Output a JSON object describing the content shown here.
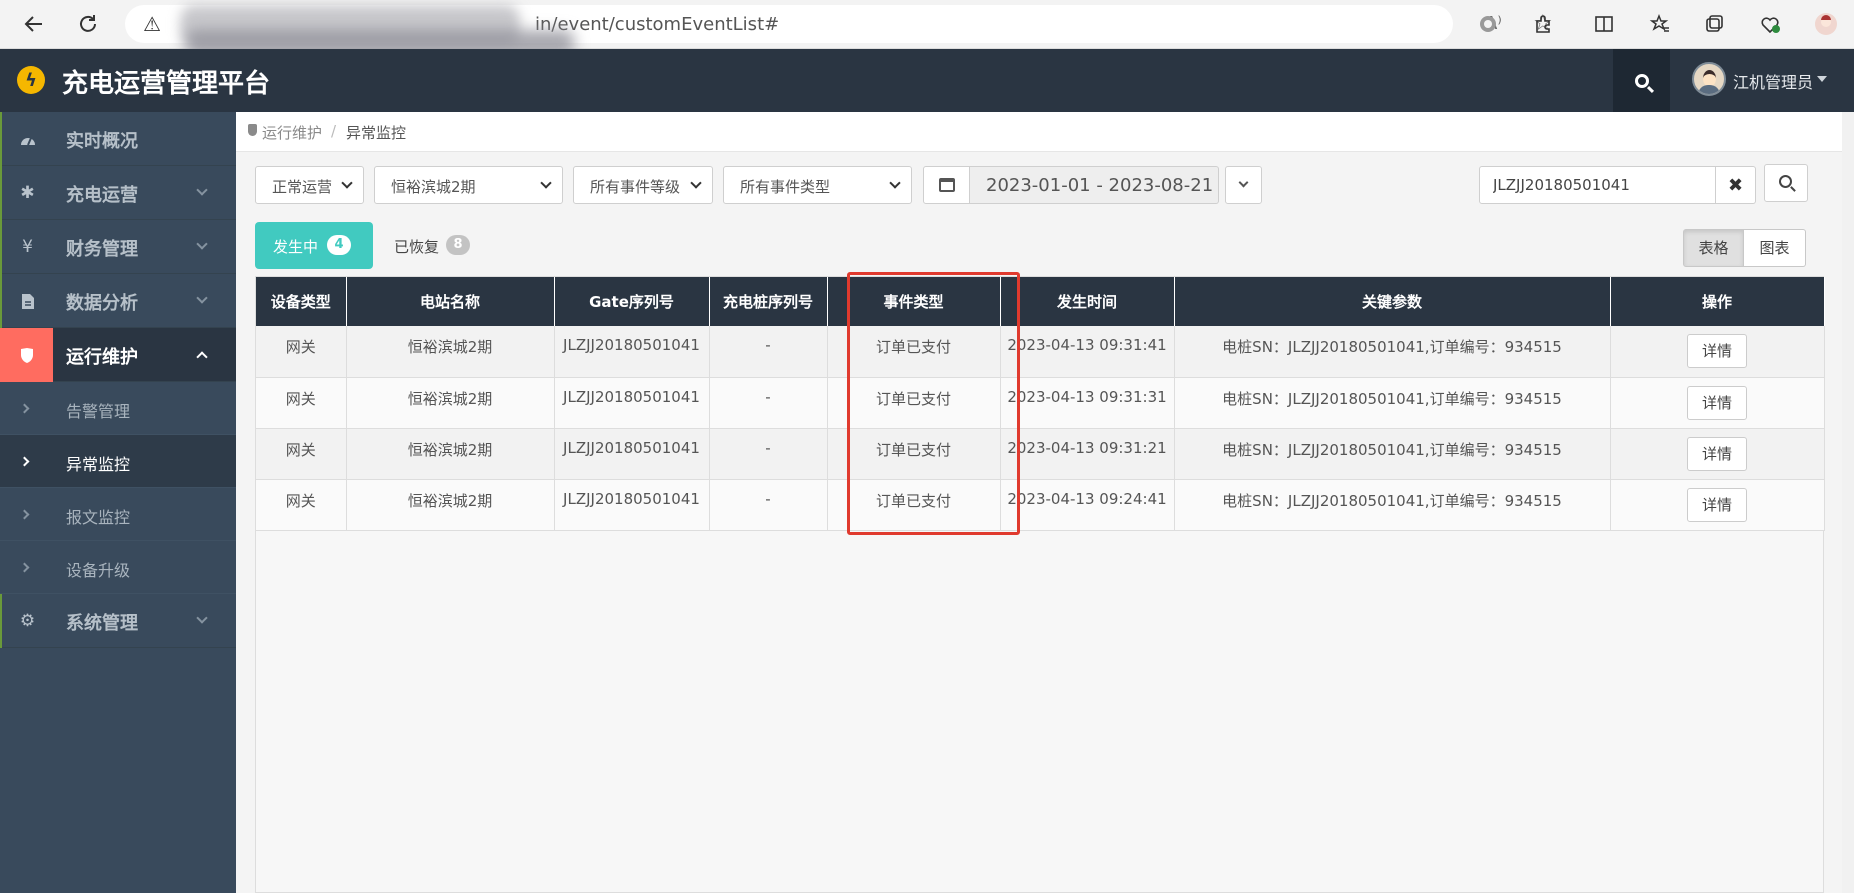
{
  "browser": {
    "url": "in/event/customEventList#",
    "read_aloud": "A⁾"
  },
  "app": {
    "title": "充电运营管理平台",
    "user": "江机管理员"
  },
  "sidebar": {
    "items": [
      {
        "label": "实时概况"
      },
      {
        "label": "充电运营"
      },
      {
        "label": "财务管理"
      },
      {
        "label": "数据分析"
      },
      {
        "label": "运行维护"
      },
      {
        "label": "系统管理"
      }
    ],
    "sub_items": [
      {
        "label": "告警管理"
      },
      {
        "label": "异常监控"
      },
      {
        "label": "报文监控"
      },
      {
        "label": "设备升级"
      }
    ]
  },
  "breadcrumb": {
    "parent": "运行维护",
    "separator": "/",
    "current": "异常监控"
  },
  "filters": {
    "status": "正常运营",
    "station": "恒裕滨城2期",
    "level": "所有事件等级",
    "type": "所有事件类型",
    "date_range": "2023-01-01 - 2023-08-21",
    "search_value": "JLZJJ20180501041"
  },
  "tabs": {
    "active_label": "发生中",
    "active_count": "4",
    "recovered_label": "已恢复",
    "recovered_count": "8"
  },
  "view_toggle": {
    "table": "表格",
    "chart": "图表"
  },
  "table": {
    "headers": [
      "设备类型",
      "电站名称",
      "Gate序列号",
      "充电桩序列号",
      "事件类型",
      "发生时间",
      "关键参数",
      "操作"
    ],
    "rows": [
      {
        "device": "网关",
        "station": "恒裕滨城2期",
        "gate": "JLZJJ20180501041",
        "pile": "-",
        "event": "订单已支付",
        "time": "2023-04-13 09:31:41",
        "params": "电桩SN：JLZJJ20180501041,订单编号：934515",
        "action": "详情"
      },
      {
        "device": "网关",
        "station": "恒裕滨城2期",
        "gate": "JLZJJ20180501041",
        "pile": "-",
        "event": "订单已支付",
        "time": "2023-04-13 09:31:31",
        "params": "电桩SN：JLZJJ20180501041,订单编号：934515",
        "action": "详情"
      },
      {
        "device": "网关",
        "station": "恒裕滨城2期",
        "gate": "JLZJJ20180501041",
        "pile": "-",
        "event": "订单已支付",
        "time": "2023-04-13 09:31:21",
        "params": "电桩SN：JLZJJ20180501041,订单编号：934515",
        "action": "详情"
      },
      {
        "device": "网关",
        "station": "恒裕滨城2期",
        "gate": "JLZJJ20180501041",
        "pile": "-",
        "event": "订单已支付",
        "time": "2023-04-13 09:24:41",
        "params": "电桩SN：JLZJJ20180501041,订单编号：934515",
        "action": "详情"
      }
    ]
  },
  "colors": {
    "header_bg": "#2a3542",
    "sidebar_bg": "#394a5c",
    "accent_teal": "#41cac0",
    "active_menu_red": "#ff6c60",
    "highlight_red": "#e03a2e"
  },
  "icons": {
    "back": "arrow-left-icon",
    "reload": "reload-icon",
    "warning": "warning-icon",
    "favorite": "star-icon",
    "logo": "lightning-icon",
    "search": "search-icon",
    "calendar": "calendar-icon",
    "clear": "close-icon"
  }
}
